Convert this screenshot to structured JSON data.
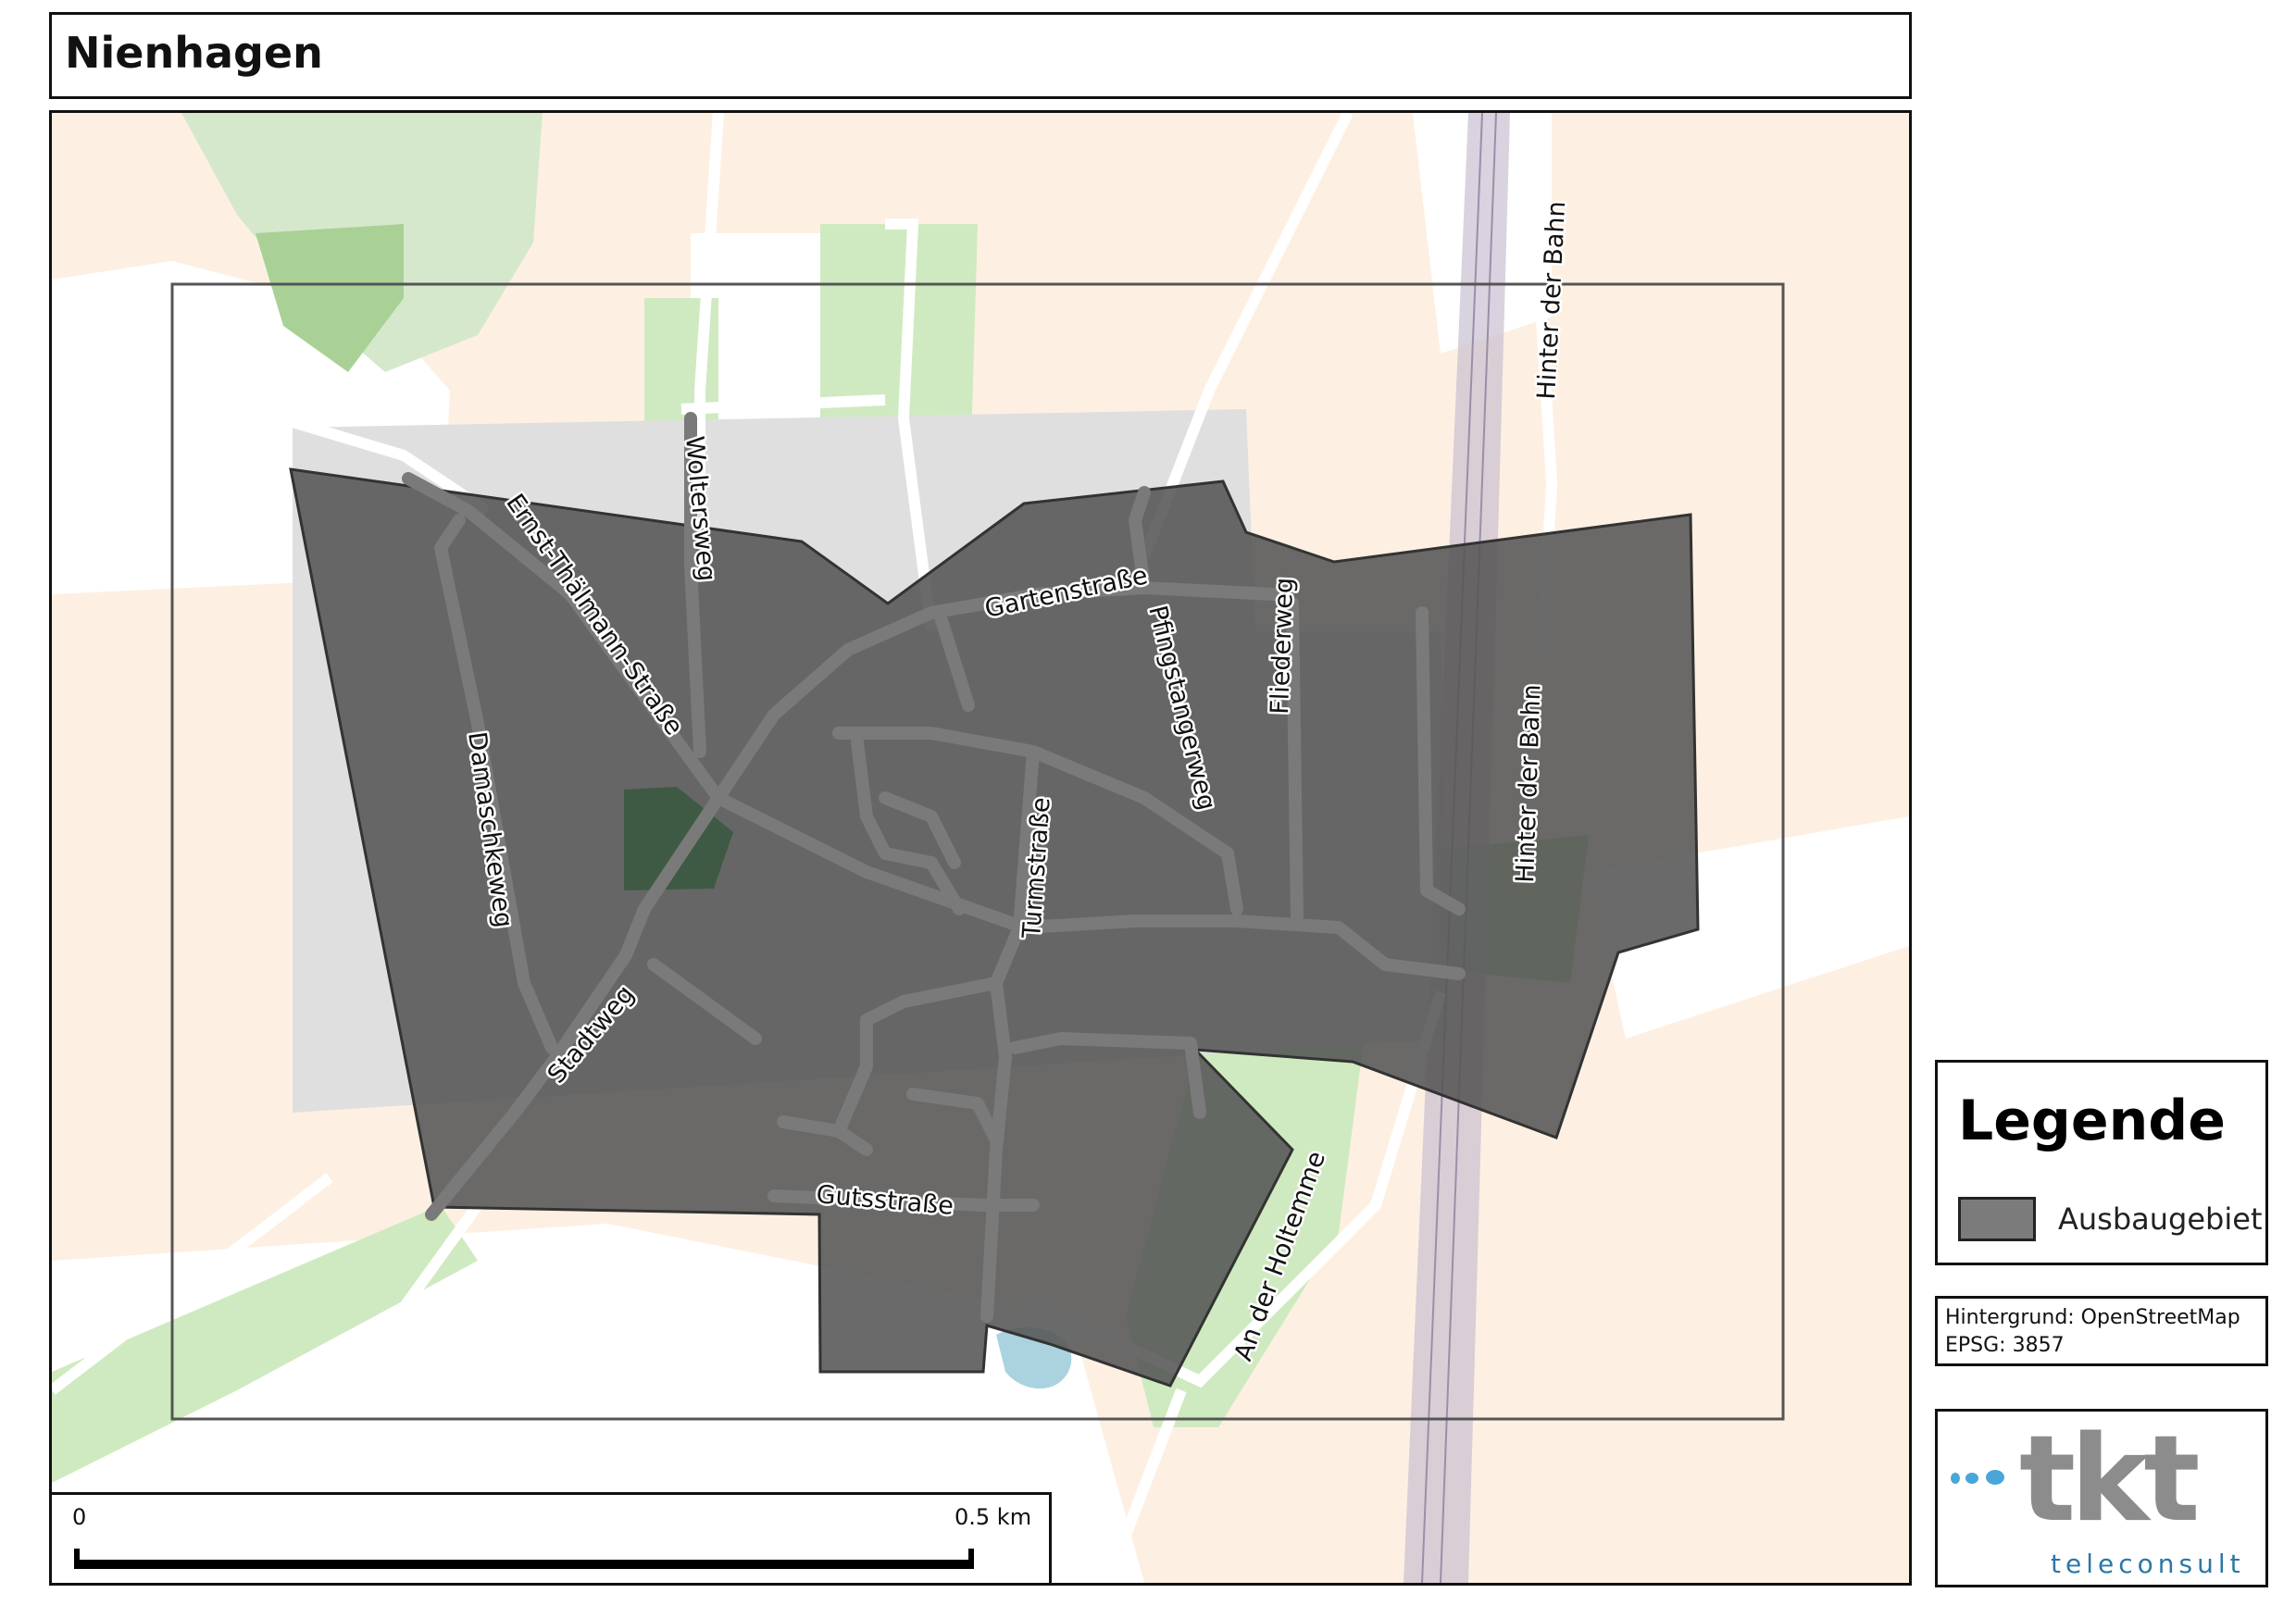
{
  "title": "Nienhagen",
  "map": {
    "streets": [
      "Ernst-Thälmann-Straße",
      "Woltersweg",
      "Gartenstraße",
      "Pfingstangerweg",
      "Fliederweg",
      "Hinter der Bahn",
      "Hinter der Bahn",
      "Damaschkeweg",
      "Turmstraße",
      "Stadtweg",
      "Gutsstraße",
      "An der Holtemme"
    ],
    "colors": {
      "landuse_farmland": "#fdf0e2",
      "landuse_grass": "#cfeac0",
      "forest": "#a9d196",
      "residential": "#e0dfdf",
      "area_fill": "#555555",
      "railway": "#c9bfd2",
      "water": "#aad3df"
    }
  },
  "scalebar": {
    "start_label": "0",
    "end_label": "0.5 km"
  },
  "legend": {
    "title": "Legende",
    "items": [
      {
        "label": "Ausbaugebiet",
        "color": "#7b7b7b"
      }
    ]
  },
  "info": {
    "background": "Hintergrund: OpenStreetMap",
    "epsg": "EPSG: 3857"
  },
  "logo": {
    "name": "tkt",
    "subtitle": "teleconsult"
  }
}
